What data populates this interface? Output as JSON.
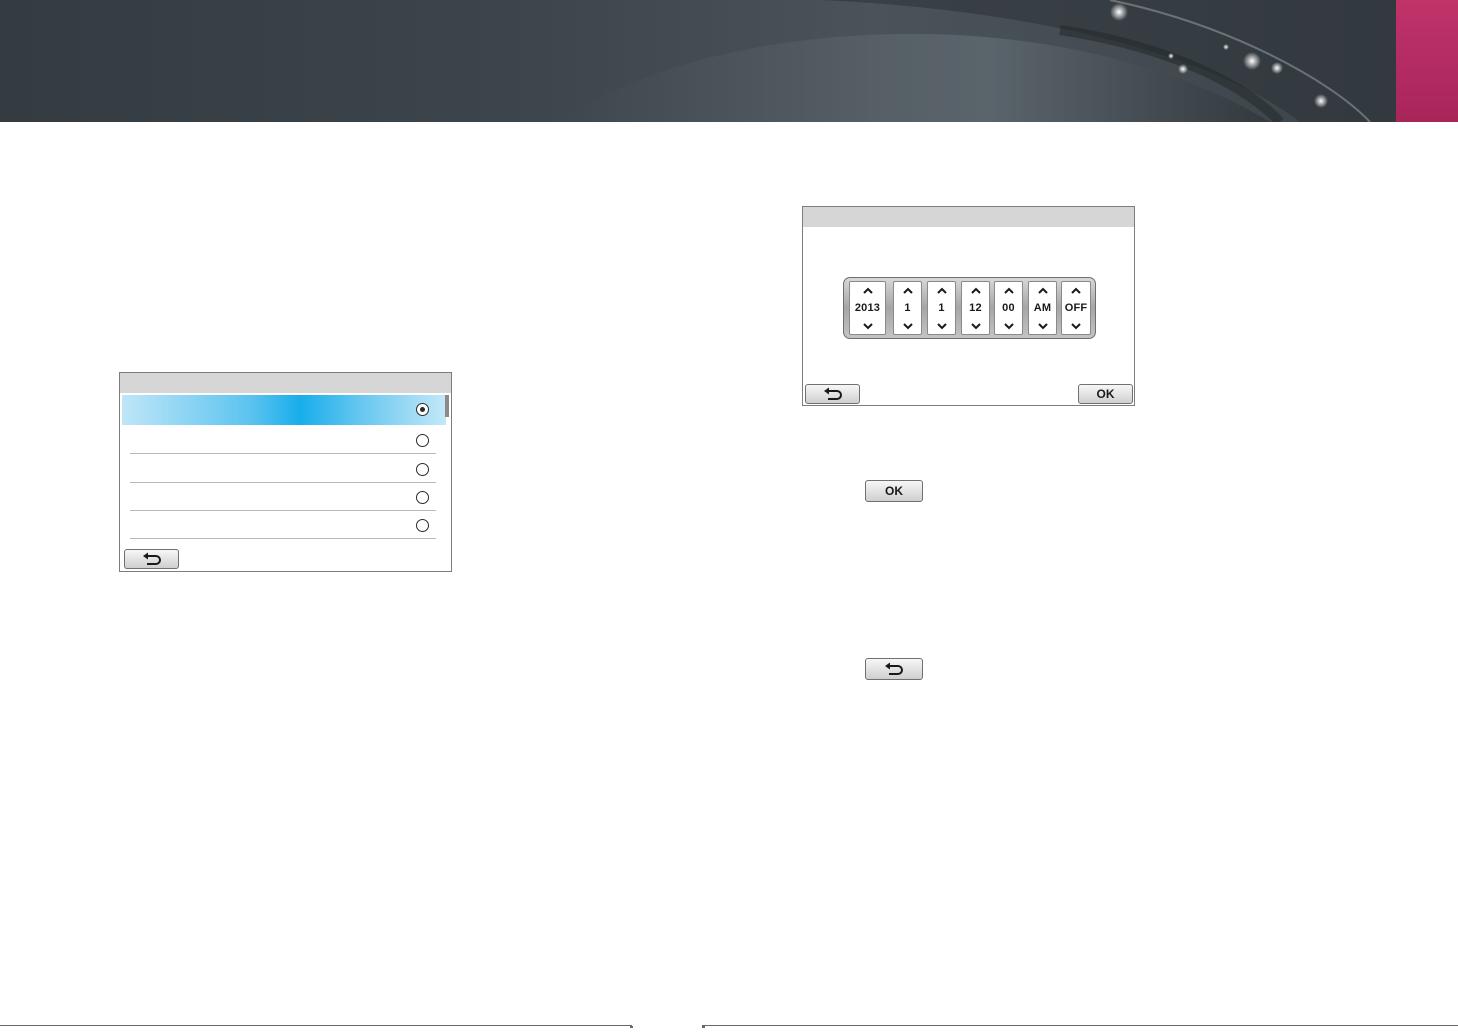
{
  "colors": {
    "banner_dark": "#343c42",
    "banner_accent_tab": "#b42b62",
    "selection_blue": "#18adeb",
    "titlebar_gray": "#d6d6d6"
  },
  "list_screen": {
    "rows": [
      {
        "selected": true
      },
      {
        "selected": false
      },
      {
        "selected": false
      },
      {
        "selected": false
      },
      {
        "selected": false
      }
    ],
    "back_icon": "return-arrow-icon"
  },
  "datetime_screen": {
    "fields": [
      {
        "id": "year",
        "value": "2013"
      },
      {
        "id": "month",
        "value": "1"
      },
      {
        "id": "day",
        "value": "1"
      },
      {
        "id": "hour",
        "value": "12"
      },
      {
        "id": "minute",
        "value": "00"
      },
      {
        "id": "meridiem",
        "value": "AM"
      },
      {
        "id": "dst",
        "value": "OFF"
      }
    ],
    "back_icon": "return-arrow-icon",
    "ok_label": "OK"
  },
  "inline_buttons": {
    "ok_label": "OK",
    "back_icon": "return-arrow-icon"
  }
}
